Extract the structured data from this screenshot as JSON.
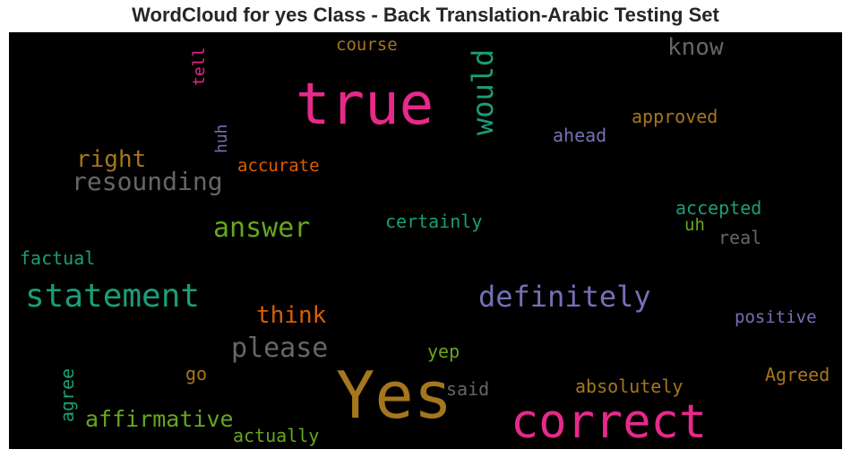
{
  "chart_data": {
    "type": "wordcloud",
    "title": "WordCloud for yes Class - Back Translation-Arabic Testing Set",
    "background": "#000000",
    "words": [
      {
        "text": "Yes",
        "color": "#A6761D"
      },
      {
        "text": "true",
        "color": "#E7298A"
      },
      {
        "text": "correct",
        "color": "#E7298A"
      },
      {
        "text": "statement",
        "color": "#1B9E77"
      },
      {
        "text": "definitely",
        "color": "#7570B3"
      },
      {
        "text": "would",
        "color": "#1B9E77"
      },
      {
        "text": "please",
        "color": "#666666"
      },
      {
        "text": "answer",
        "color": "#66A61E"
      },
      {
        "text": "resounding",
        "color": "#666666"
      },
      {
        "text": "affirmative",
        "color": "#66A61E"
      },
      {
        "text": "right",
        "color": "#A6761D"
      },
      {
        "text": "think",
        "color": "#D95F02"
      },
      {
        "text": "know",
        "color": "#666666"
      },
      {
        "text": "absolutely",
        "color": "#A6761D"
      },
      {
        "text": "certainly",
        "color": "#1B9E77"
      },
      {
        "text": "accepted",
        "color": "#1B9E77"
      },
      {
        "text": "approved",
        "color": "#A6761D"
      },
      {
        "text": "accurate",
        "color": "#D95F02"
      },
      {
        "text": "positive",
        "color": "#7570B3"
      },
      {
        "text": "Agreed",
        "color": "#A6761D"
      },
      {
        "text": "factual",
        "color": "#1B9E77"
      },
      {
        "text": "actually",
        "color": "#66A61E"
      },
      {
        "text": "ahead",
        "color": "#7570B3"
      },
      {
        "text": "course",
        "color": "#A6761D"
      },
      {
        "text": "agree",
        "color": "#1B9E77"
      },
      {
        "text": "real",
        "color": "#666666"
      },
      {
        "text": "said",
        "color": "#666666"
      },
      {
        "text": "yep",
        "color": "#66A61E"
      },
      {
        "text": "go",
        "color": "#A6761D"
      },
      {
        "text": "tell",
        "color": "#E7298A"
      },
      {
        "text": "huh",
        "color": "#7570B3"
      },
      {
        "text": "uh",
        "color": "#66A61E"
      }
    ]
  }
}
